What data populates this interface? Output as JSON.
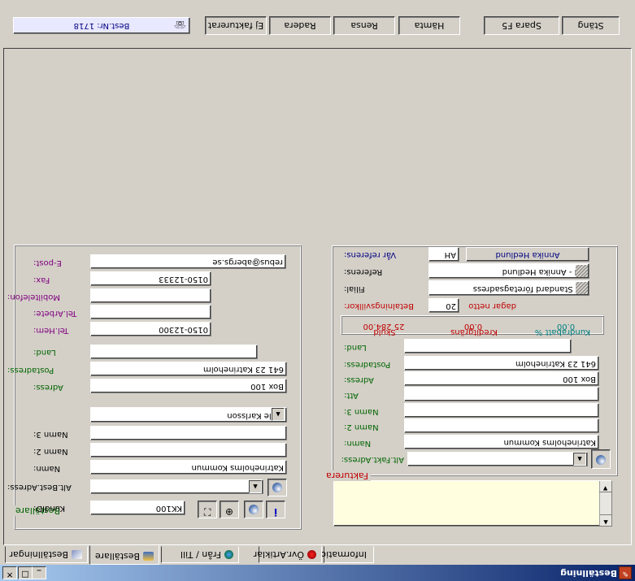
{
  "window": {
    "title": "Beställning",
    "minimize": "_",
    "maximize": "□",
    "close": "✕"
  },
  "tabs": [
    {
      "label": "Beställningar"
    },
    {
      "label": "Beställare"
    },
    {
      "label": "Från / Till"
    },
    {
      "label": "Övr.Artiklar"
    },
    {
      "label": "Information"
    }
  ],
  "toolbar": {
    "order_number": "Best.Nr: 1718",
    "buttons": [
      "Ej fakturerat",
      "Radera",
      "Rensa",
      "Hämta",
      "Spara F5",
      "Stäng"
    ]
  },
  "bestallare": {
    "group_label": "Beställare",
    "kundid_label": "KundID:",
    "kundid": "KK100",
    "alt_best_adress_label": "Alt.Best.Adress:",
    "alt_best_adress": "",
    "namn_label": "Namn:",
    "namn": "Katrineholms Kommun",
    "namn2_label": "Namn 2:",
    "namn2": "",
    "namn3_label": "Namn 3:",
    "namn3": "",
    "kontakt": "Kalle Karlsson",
    "adress_label": "Adress:",
    "adress": "Box 100",
    "postadress_label": "Postadress:",
    "postadress": "641 23 Katrineholm",
    "land_label": "Land:",
    "land": "",
    "tel_hem_label": "Tel.Hem:",
    "tel_hem": "0150-12300",
    "tel_arbete_label": "Tel.Arbete:",
    "tel_arbete": "",
    "mobiltelefon_label": "Mobiltelefon:",
    "mobiltelefon": "",
    "fax_label": "Fax:",
    "fax": "0150-12333",
    "epost_label": "E-post:",
    "epost": "rebus@abergs.se"
  },
  "fakturera": {
    "group_label": "Fakturera",
    "alt_fakt_adress_label": "Alt.Fakt.Adress:",
    "alt_fakt_adress": "",
    "namn_label": "Namn:",
    "namn": "Katrineholms Kommun",
    "namn2_label": "Namn 2:",
    "namn2": "",
    "namn3_label": "Namn 3:",
    "namn3": "",
    "att_label": "Att:",
    "att": "",
    "adress_label": "Adress:",
    "adress": "Box 100",
    "postadress_label": "Postadress:",
    "postadress": "641 23 Katrineholm",
    "land_label": "Land:",
    "land": "",
    "summary": {
      "skuld_label": "Skuld",
      "skuld": "25 284.00",
      "kreditgrans_label": "Kreditgräns",
      "kreditgrans": "0.00",
      "kundrabatt_label": "Kundrabatt %",
      "kundrabatt": "0.00"
    },
    "betalningsvillkor_label": "Betalningsvillkor:",
    "betalningsvillkor": "20",
    "betalningsvillkor_suffix": "dagar netto",
    "filial_label": "Filial:",
    "filial": "0 - Standard företagsadress",
    "referens_label": "Referens:",
    "referens": "AH    - Annika Hedlund",
    "var_referens_label": "Vår referens:",
    "var_referens": "AH",
    "var_referens_name": "Annika Hedlund"
  },
  "colors": {
    "label_green": "#006400",
    "label_purple": "#800080",
    "memo_bg": "#ffffe0"
  }
}
